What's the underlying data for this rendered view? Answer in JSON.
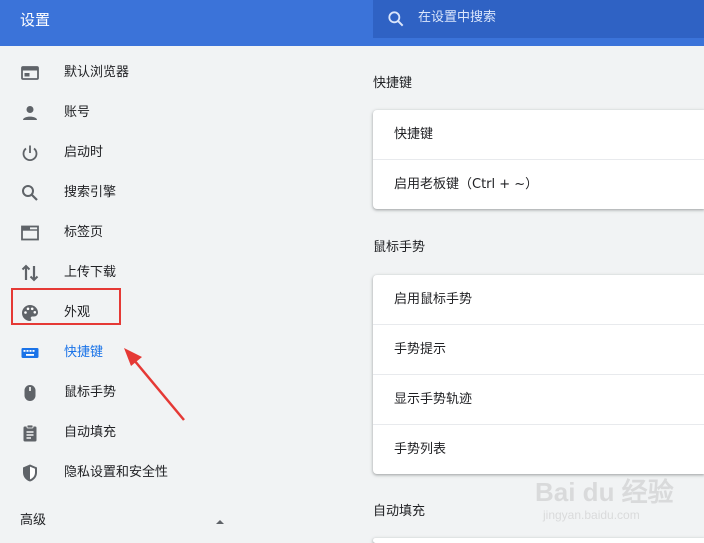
{
  "header": {
    "title": "设置",
    "search_placeholder": "在设置中搜索",
    "accent_color": "#3b73d9"
  },
  "sidebar": {
    "items": [
      {
        "label": "默认浏览器",
        "icon": "browser-window-icon"
      },
      {
        "label": "账号",
        "icon": "person-icon"
      },
      {
        "label": "启动时",
        "icon": "power-icon"
      },
      {
        "label": "搜索引擎",
        "icon": "search-icon"
      },
      {
        "label": "标签页",
        "icon": "tab-icon"
      },
      {
        "label": "上传下载",
        "icon": "up-down-arrows-icon"
      },
      {
        "label": "外观",
        "icon": "palette-icon"
      },
      {
        "label": "快捷键",
        "icon": "keyboard-icon",
        "active": true
      },
      {
        "label": "鼠标手势",
        "icon": "mouse-icon"
      },
      {
        "label": "自动填充",
        "icon": "clipboard-icon"
      },
      {
        "label": "隐私设置和安全性",
        "icon": "shield-icon"
      }
    ],
    "advanced_label": "高级",
    "active_color": "#1a73e8"
  },
  "main": {
    "sections": [
      {
        "title": "快捷键",
        "rows": [
          "快捷键",
          "启用老板键（Ctrl + ~）"
        ]
      },
      {
        "title": "鼠标手势",
        "rows": [
          "启用鼠标手势",
          "手势提示",
          "显示手势轨迹",
          "手势列表"
        ]
      },
      {
        "title": "自动填充",
        "rows": []
      }
    ]
  },
  "watermark": {
    "brand": "Bai du 经验",
    "url": "jingyan.baidu.com"
  }
}
